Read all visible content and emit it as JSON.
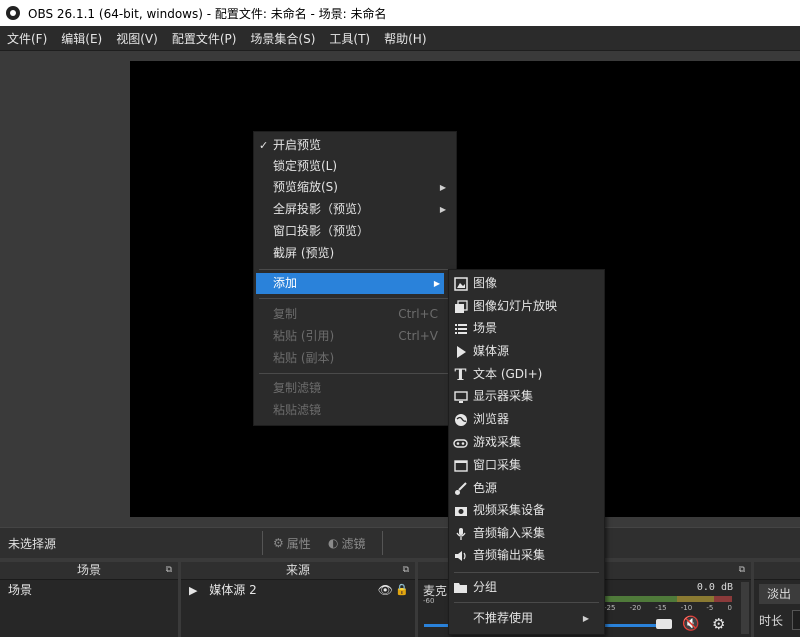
{
  "window": {
    "title": "OBS 26.1.1 (64-bit, windows) - 配置文件: 未命名 - 场景: 未命名"
  },
  "menubar": [
    "文件(F)",
    "编辑(E)",
    "视图(V)",
    "配置文件(P)",
    "场景集合(S)",
    "工具(T)",
    "帮助(H)"
  ],
  "source_toolbar": {
    "no_selection": "未选择源",
    "properties": "属性",
    "filters": "滤镜"
  },
  "docks": {
    "scenes": {
      "title": "场景",
      "items": [
        "场景"
      ]
    },
    "sources": {
      "title": "来源",
      "items": [
        "媒体源 2"
      ]
    },
    "mixer": {
      "label": "麦克",
      "db": "0.0 dB",
      "ticks": [
        "-60",
        "-25",
        "-20",
        "-15",
        "-10",
        "-5",
        "0"
      ]
    },
    "transitions": {
      "fade": "淡出",
      "duration": "时长"
    }
  },
  "context_menu": {
    "enable_preview": "开启预览",
    "lock_preview": "锁定预览(L)",
    "preview_scaling": "预览缩放(S)",
    "fullscreen_projector": "全屏投影（预览）",
    "windowed_projector": "窗口投影（预览）",
    "screenshot": "截屏 (预览)",
    "add": "添加",
    "copy": "复制",
    "copy_shortcut": "Ctrl+C",
    "paste_ref": "粘贴 (引用)",
    "paste_shortcut": "Ctrl+V",
    "paste_dup": "粘贴 (副本)",
    "copy_filters": "复制滤镜",
    "paste_filters": "粘贴滤镜"
  },
  "add_submenu": [
    {
      "icon": "image-icon",
      "label": "图像"
    },
    {
      "icon": "slideshow-icon",
      "label": "图像幻灯片放映"
    },
    {
      "icon": "list-icon",
      "label": "场景"
    },
    {
      "icon": "play-icon",
      "label": "媒体源"
    },
    {
      "icon": "text-icon",
      "label": "文本 (GDI+)"
    },
    {
      "icon": "monitor-icon",
      "label": "显示器采集"
    },
    {
      "icon": "globe-icon",
      "label": "浏览器"
    },
    {
      "icon": "gamepad-icon",
      "label": "游戏采集"
    },
    {
      "icon": "window-icon",
      "label": "窗口采集"
    },
    {
      "icon": "brush-icon",
      "label": "色源"
    },
    {
      "icon": "camera-icon",
      "label": "视频采集设备"
    },
    {
      "icon": "microphone-icon",
      "label": "音频输入采集"
    },
    {
      "icon": "speaker-icon",
      "label": "音频输出采集"
    },
    {
      "icon": "folder-icon",
      "label": "分组"
    },
    {
      "icon": "",
      "label": "不推荐使用"
    }
  ]
}
